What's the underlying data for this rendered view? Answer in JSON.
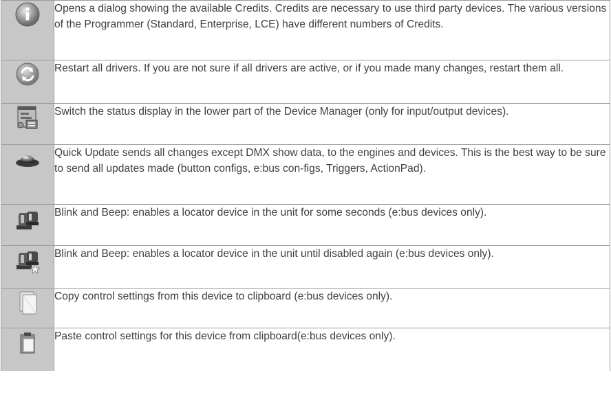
{
  "rows": [
    {
      "icon": "info-icon",
      "text": "Opens a dialog showing the available Credits. Credits are necessary to use third party devices. The various versions of the Programmer (Standard, Enterprise, LCE) have different numbers of Credits."
    },
    {
      "icon": "restart-drivers-icon",
      "text": "Restart all drivers. If you are not sure if all drivers are active, or if you made many changes, restart them all."
    },
    {
      "icon": "status-display-icon",
      "text": "Switch the status display in the lower part of the Device Manager (only for input/output devices)."
    },
    {
      "icon": "quick-update-icon",
      "text": "Quick Update sends all changes except DMX show data, to the engines and devices. This is the best way to be sure to send all updates made (button configs, e:bus con-figs, Triggers, ActionPad)."
    },
    {
      "icon": "blink-beep-icon",
      "text": "Blink and Beep: enables a locator device in the unit for some seconds (e:bus devices only)."
    },
    {
      "icon": "blink-beep-persistent-icon",
      "text": "Blink and Beep: enables a locator device in the unit until disabled again (e:bus devices only)."
    },
    {
      "icon": "copy-icon",
      "text": "Copy control settings from this device to clipboard (e:bus devices only)."
    },
    {
      "icon": "paste-icon",
      "text": "Paste control settings for this device from clipboard(e:bus devices only)."
    }
  ]
}
